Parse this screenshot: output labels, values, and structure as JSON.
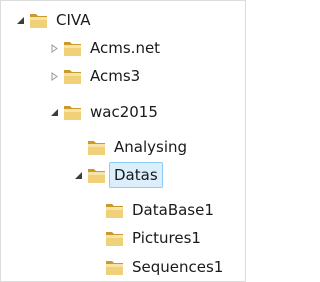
{
  "tree": {
    "nodes": [
      {
        "label": "CIVA",
        "state": "expanded"
      },
      {
        "label": "Acms.net",
        "state": "collapsed"
      },
      {
        "label": "Acms3",
        "state": "collapsed"
      },
      {
        "label": "wac2015",
        "state": "expanded"
      },
      {
        "label": "Analysing",
        "state": "leaf"
      },
      {
        "label": "Datas",
        "state": "expanded",
        "selected": true
      },
      {
        "label": "DataBase1",
        "state": "leaf"
      },
      {
        "label": "Pictures1",
        "state": "leaf"
      },
      {
        "label": "Sequences1",
        "state": "leaf"
      }
    ]
  },
  "colors": {
    "selection_fill": "#dbeefb",
    "selection_border": "#8ecbf2",
    "folder_yellow": "#e8c25a"
  },
  "icons": {
    "expanded": "chevron-expanded-icon",
    "collapsed": "chevron-collapsed-icon",
    "folder": "folder-icon"
  }
}
